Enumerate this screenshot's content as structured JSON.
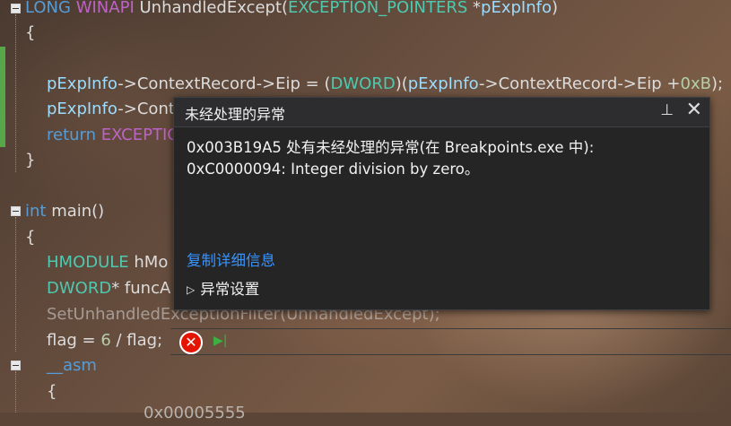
{
  "code": {
    "l1": {
      "kw1": "LONG",
      "kw2": "WINAPI",
      "fn": "UnhandledExcept(",
      "ty": "EXCEPTION_POINTERS",
      "star": " *",
      "param": "pExpInfo",
      "end": ")"
    },
    "l2": "{",
    "l3": {
      "v1": "pExpInfo",
      "t1": "->ContextRecord->Eip = (",
      "ty": "DWORD",
      "t2": ")(",
      "v2": "pExpInfo",
      "t3": "->ContextRecord->Eip +",
      "num": "0xB",
      "t4": ");"
    },
    "l4": {
      "v1": "pExpInfo",
      "t1": "->Cont"
    },
    "l5": {
      "kw": "return",
      "mac": "EXCEPTIO"
    },
    "l6": "}",
    "l7": {
      "kw": "int",
      "t": " main()"
    },
    "l8": "{",
    "l9": {
      "ty": "HMODULE",
      "t": " hMo"
    },
    "l10": {
      "ty": "DWORD",
      "t": "* funcA"
    },
    "l11": "SetUnhandledExceptionFilter(UnhandledExcept);",
    "l12": {
      "t1": "flag = ",
      "num": "6",
      "t2": " / flag;"
    },
    "l13": {
      "kw": "__asm"
    },
    "l14": "{",
    "l15": "0x00005555"
  },
  "popup": {
    "title": "未经处理的异常",
    "message_line1": "0x003B19A5 处有未经处理的异常(在 Breakpoints.exe 中):",
    "message_line2": "0xC0000094: Integer division by zero。",
    "copy_details": "复制详细信息",
    "exception_settings": "异常设置"
  },
  "colors": {
    "error": "#e51400",
    "link": "#3794ff",
    "keyword": "#569cd6",
    "type": "#4ec9b0",
    "macro": "#bd63c5"
  },
  "icons": [
    "pin-icon",
    "close-icon",
    "error-icon",
    "run-to-here-icon",
    "collapse-icon",
    "expand-triangle-icon"
  ]
}
